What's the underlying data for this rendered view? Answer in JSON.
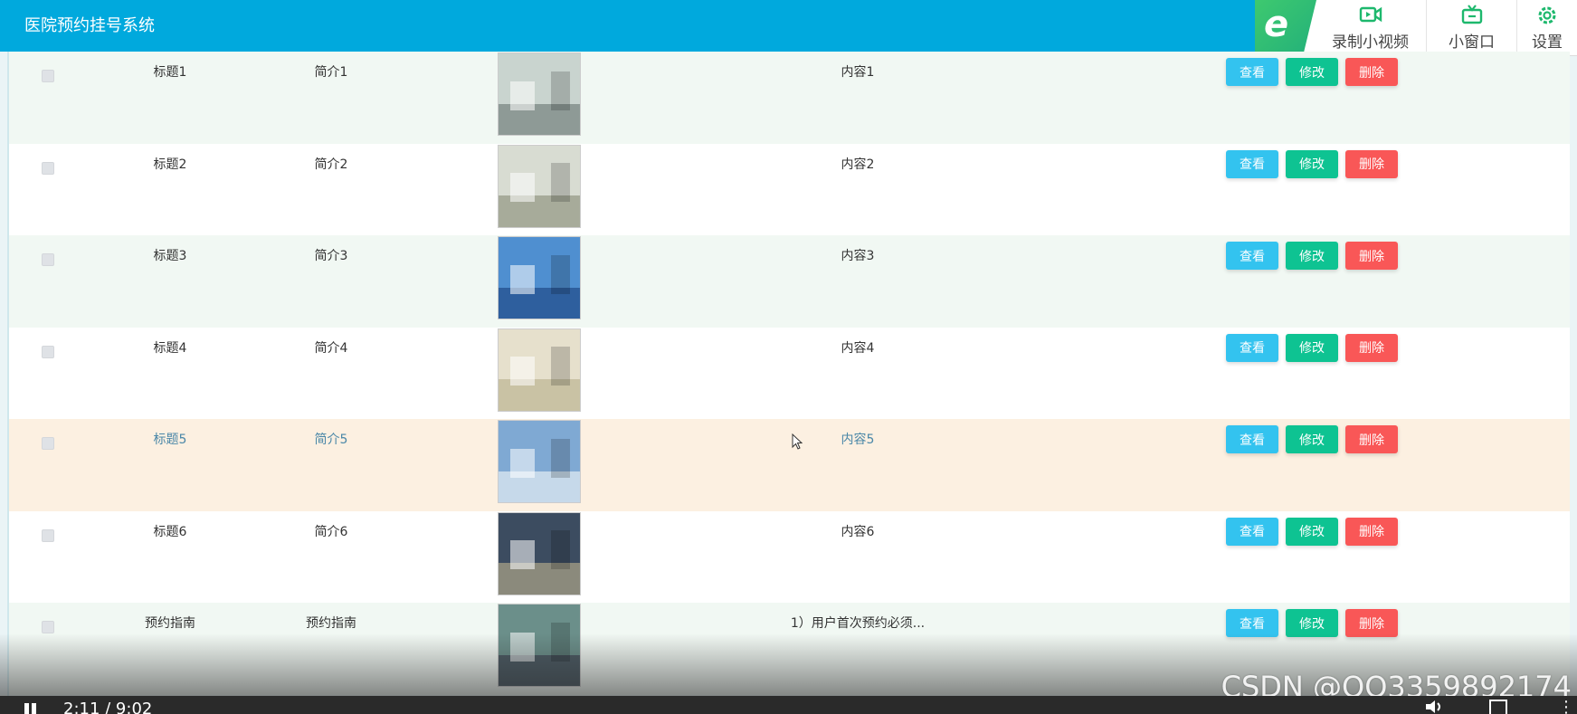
{
  "app": {
    "title": "医院预约挂号系统"
  },
  "toolbar": {
    "record_label": "录制小视频",
    "mini_window_label": "小窗口",
    "settings_label": "设置",
    "logo_icon": "browser-e-icon",
    "accent": "#1db86d"
  },
  "table": {
    "rows": [
      {
        "title": "标题1",
        "brief": "简介1",
        "content": "内容1",
        "image": {
          "top": "#c9d4cf",
          "floor": "#8e9a96"
        }
      },
      {
        "title": "标题2",
        "brief": "简介2",
        "content": "内容2",
        "image": {
          "top": "#d8dcd2",
          "floor": "#a7ab9a"
        }
      },
      {
        "title": "标题3",
        "brief": "简介3",
        "content": "内容3",
        "image": {
          "top": "#4f8fd0",
          "floor": "#2e5f9e"
        }
      },
      {
        "title": "标题4",
        "brief": "简介4",
        "content": "内容4",
        "image": {
          "top": "#e6e0cc",
          "floor": "#c9c2a4"
        }
      },
      {
        "title": "标题5",
        "brief": "简介5",
        "content": "内容5",
        "image": {
          "top": "#7fa9d3",
          "floor": "#c6d9ea"
        }
      },
      {
        "title": "标题6",
        "brief": "简介6",
        "content": "内容6",
        "image": {
          "top": "#3c4c60",
          "floor": "#8b8a7c"
        }
      },
      {
        "title": "预约指南",
        "brief": "预约指南",
        "content": "1）用户首次预约必须...",
        "image": {
          "top": "#6b8f8a",
          "floor": "#4b5a63"
        }
      }
    ],
    "actions": {
      "view": "查看",
      "edit": "修改",
      "delete": "删除"
    },
    "hover_row_index": 4,
    "colors": {
      "view": "#33c3ef",
      "edit": "#0ec392",
      "delete": "#f95757",
      "header": "#00a9dd"
    }
  },
  "player": {
    "time": "2:11 / 9:02"
  },
  "watermark": "CSDN @QQ3359892174"
}
